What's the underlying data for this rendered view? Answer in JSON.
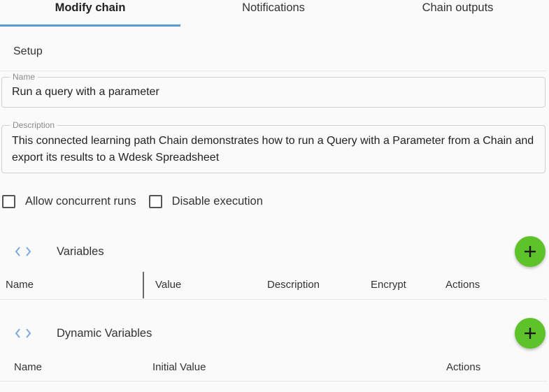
{
  "tabs": [
    {
      "label": "Modify chain",
      "active": true
    },
    {
      "label": "Notifications",
      "active": false
    },
    {
      "label": "Chain outputs",
      "active": false
    }
  ],
  "setup": {
    "title": "Setup"
  },
  "name_field": {
    "label": "Name",
    "value": "Run a query with a parameter"
  },
  "description_field": {
    "label": "Description",
    "value": "This connected learning path Chain demonstrates how to run a Query with a Parameter from a Chain and export its results to a Wdesk Spreadsheet"
  },
  "checkboxes": [
    {
      "label": "Allow concurrent runs",
      "checked": false
    },
    {
      "label": "Disable execution",
      "checked": false
    }
  ],
  "variables": {
    "title": "Variables",
    "columns": [
      "Name",
      "Value",
      "Description",
      "Encrypt",
      "Actions"
    ]
  },
  "dynamic_variables": {
    "title": "Dynamic Variables",
    "columns": [
      "Name",
      "Initial Value",
      "Actions"
    ]
  },
  "icons": {
    "section": "code-brackets-icon",
    "add": "plus-icon"
  },
  "colors": {
    "accent": "#5b9bd5",
    "fab": "#5ec32a",
    "code_icon": "#7fa8e0"
  }
}
